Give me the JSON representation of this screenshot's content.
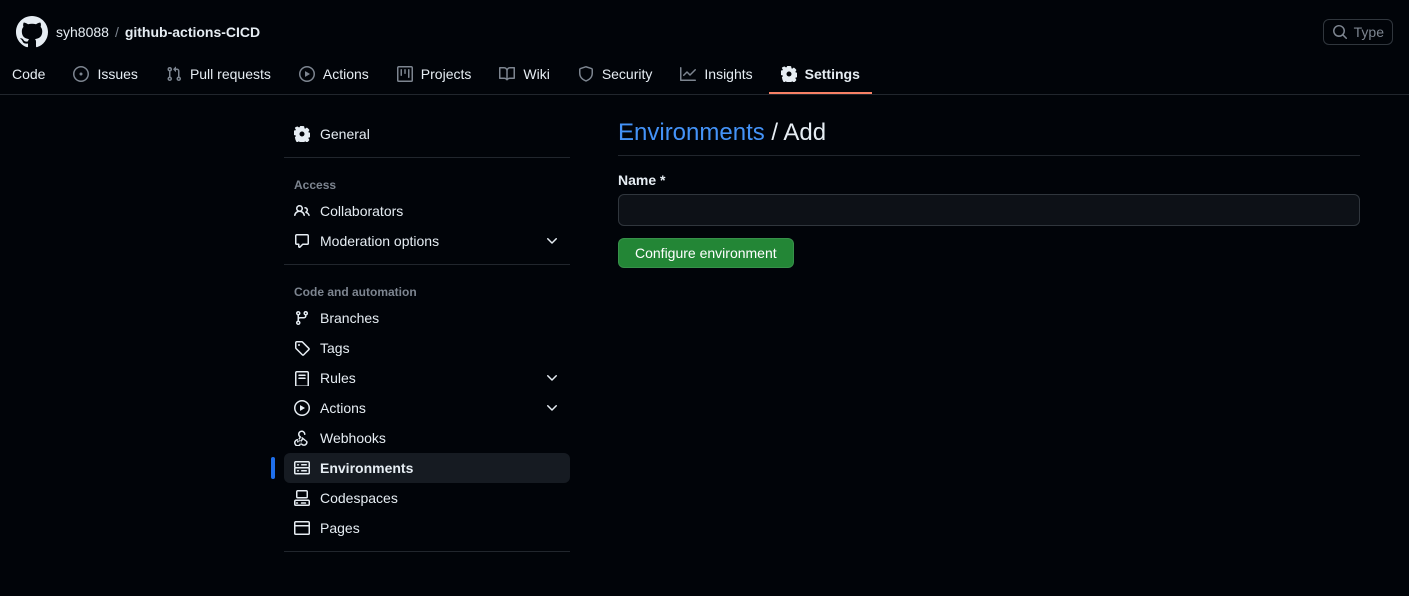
{
  "header": {
    "owner": "syh8088",
    "repo": "github-actions-CICD",
    "search_placeholder": "Type"
  },
  "tabs": [
    {
      "label": "Code"
    },
    {
      "label": "Issues"
    },
    {
      "label": "Pull requests"
    },
    {
      "label": "Actions"
    },
    {
      "label": "Projects"
    },
    {
      "label": "Wiki"
    },
    {
      "label": "Security"
    },
    {
      "label": "Insights"
    },
    {
      "label": "Settings"
    }
  ],
  "sidebar": {
    "general": "General",
    "access_title": "Access",
    "collaborators": "Collaborators",
    "moderation": "Moderation options",
    "code_title": "Code and automation",
    "branches": "Branches",
    "tags": "Tags",
    "rules": "Rules",
    "actions": "Actions",
    "webhooks": "Webhooks",
    "environments": "Environments",
    "codespaces": "Codespaces",
    "pages": "Pages"
  },
  "content": {
    "environments_link": "Environments",
    "add_text": "Add",
    "name_label": "Name *",
    "name_value": "",
    "configure_btn": "Configure environment"
  }
}
